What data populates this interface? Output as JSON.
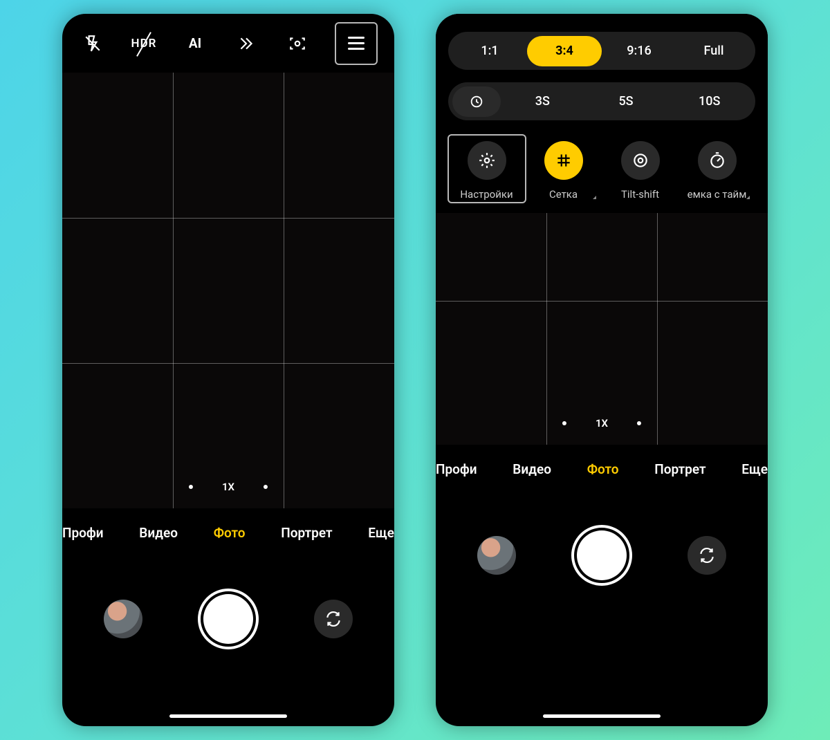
{
  "accent": "#ffcc00",
  "left": {
    "toolbar": {
      "hdr_label": "HDR",
      "ai_label": "AI"
    }
  },
  "ratios": [
    "1:1",
    "3:4",
    "9:16",
    "Full"
  ],
  "ratio_active_index": 1,
  "timers": [
    "3S",
    "5S",
    "10S"
  ],
  "options": [
    {
      "label": "Настройки",
      "icon": "gear",
      "active": false,
      "highlighted": true,
      "hasMore": false
    },
    {
      "label": "Сетка",
      "icon": "grid",
      "active": true,
      "highlighted": false,
      "hasMore": true
    },
    {
      "label": "Tilt-shift",
      "icon": "target",
      "active": false,
      "highlighted": false,
      "hasMore": false
    },
    {
      "label": "емка с тайм",
      "icon": "timer",
      "active": false,
      "highlighted": false,
      "hasMore": true
    }
  ],
  "zoom_label": "1X",
  "modes": [
    {
      "label": "Профи",
      "active": false,
      "clip": "left"
    },
    {
      "label": "Видео",
      "active": false
    },
    {
      "label": "Фото",
      "active": true
    },
    {
      "label": "Портрет",
      "active": false
    },
    {
      "label": "Еще",
      "active": false,
      "clip": "right"
    }
  ]
}
